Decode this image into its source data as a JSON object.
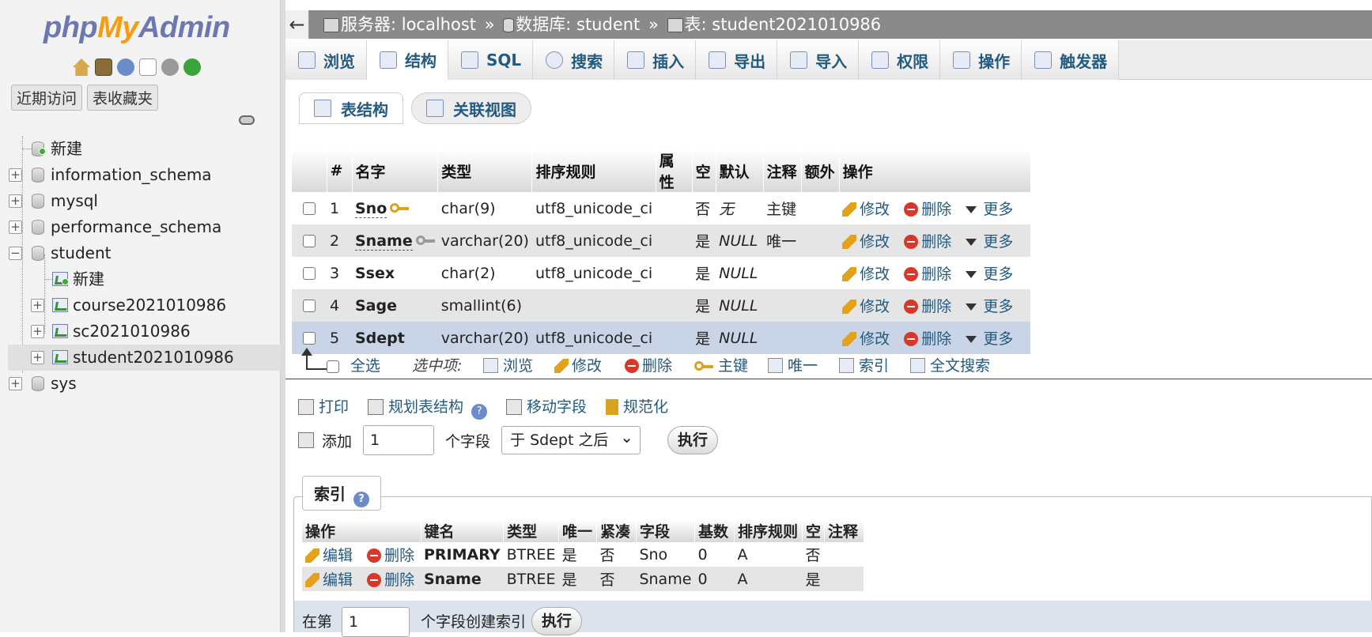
{
  "nav": {
    "logo": {
      "php": "php",
      "my": "My",
      "admin": "Admin"
    },
    "tabs": [
      "近期访问",
      "表收藏夹"
    ],
    "tree": [
      {
        "label": "新建",
        "kind": "new-db"
      },
      {
        "label": "information_schema",
        "kind": "db"
      },
      {
        "label": "mysql",
        "kind": "db"
      },
      {
        "label": "performance_schema",
        "kind": "db"
      },
      {
        "label": "student",
        "kind": "db-open"
      },
      {
        "label": "新建",
        "kind": "new-table"
      },
      {
        "label": "course2021010986",
        "kind": "table"
      },
      {
        "label": "sc2021010986",
        "kind": "table"
      },
      {
        "label": "student2021010986",
        "kind": "table-selected"
      },
      {
        "label": "sys",
        "kind": "db"
      }
    ]
  },
  "breadcrumb": {
    "server": "服务器: localhost",
    "database": "数据库: student",
    "table": "表: student2021010986",
    "sep": "»"
  },
  "tabs": [
    "浏览",
    "结构",
    "SQL",
    "搜索",
    "插入",
    "导出",
    "导入",
    "权限",
    "操作",
    "触发器"
  ],
  "subtabs": [
    "表结构",
    "关联视图"
  ],
  "structure": {
    "headers": [
      "#",
      "名字",
      "类型",
      "排序规则",
      "属性",
      "空",
      "默认",
      "注释",
      "额外",
      "操作"
    ],
    "rows": [
      {
        "num": "1",
        "name": "Sno",
        "type": "char(9)",
        "collation": "utf8_unicode_ci",
        "attr": "",
        "null": "否",
        "default": "无",
        "comment": "主键",
        "extra": "",
        "key": "primary"
      },
      {
        "num": "2",
        "name": "Sname",
        "type": "varchar(20)",
        "collation": "utf8_unicode_ci",
        "attr": "",
        "null": "是",
        "default": "NULL",
        "comment": "唯一",
        "extra": "",
        "key": "unique"
      },
      {
        "num": "3",
        "name": "Ssex",
        "type": "char(2)",
        "collation": "utf8_unicode_ci",
        "attr": "",
        "null": "是",
        "default": "NULL",
        "comment": "",
        "extra": "",
        "key": ""
      },
      {
        "num": "4",
        "name": "Sage",
        "type": "smallint(6)",
        "collation": "",
        "attr": "",
        "null": "是",
        "default": "NULL",
        "comment": "",
        "extra": "",
        "key": ""
      },
      {
        "num": "5",
        "name": "Sdept",
        "type": "varchar(20)",
        "collation": "utf8_unicode_ci",
        "attr": "",
        "null": "是",
        "default": "NULL",
        "comment": "",
        "extra": "",
        "key": ""
      }
    ],
    "actions": {
      "edit": "修改",
      "drop": "删除",
      "more": "更多"
    }
  },
  "with_selected": {
    "check_all": "全选",
    "label": "选中项:",
    "actions": [
      "浏览",
      "修改",
      "删除",
      "主键",
      "唯一",
      "索引",
      "全文搜索"
    ]
  },
  "tools": {
    "print": "打印",
    "propose": "规划表结构",
    "move": "移动字段",
    "normalize": "规范化"
  },
  "add_fields": {
    "label": "添加",
    "count": "1",
    "unit": "个字段",
    "position": "于 Sdept 之后",
    "go": "执行"
  },
  "indexes": {
    "legend": "索引",
    "headers": [
      "操作",
      "键名",
      "类型",
      "唯一",
      "紧凑",
      "字段",
      "基数",
      "排序规则",
      "空",
      "注释"
    ],
    "edit": "编辑",
    "drop": "删除",
    "rows": [
      {
        "key": "PRIMARY",
        "type": "BTREE",
        "unique": "是",
        "packed": "否",
        "field": "Sno",
        "cardinality": "0",
        "collation": "A",
        "null": "否",
        "comment": ""
      },
      {
        "key": "Sname",
        "type": "BTREE",
        "unique": "是",
        "packed": "否",
        "field": "Sname",
        "cardinality": "0",
        "collation": "A",
        "null": "是",
        "comment": ""
      }
    ],
    "create": {
      "prefix": "在第",
      "count": "1",
      "suffix": "个字段创建索引",
      "go": "执行"
    }
  }
}
